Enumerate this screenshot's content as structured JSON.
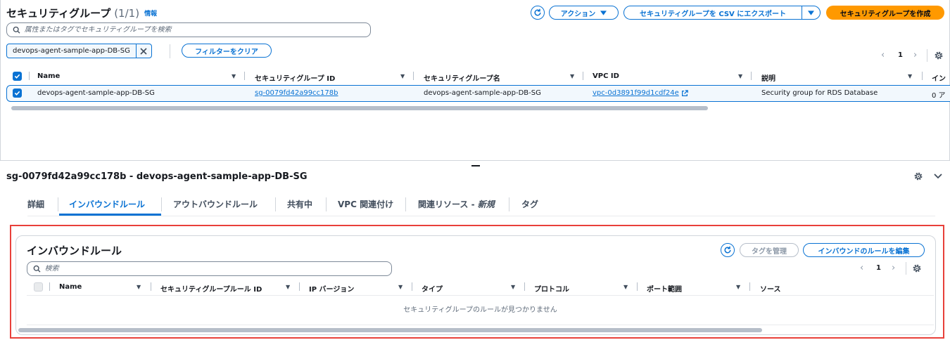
{
  "header": {
    "title": "セキュリティグループ",
    "count": "(1/1)",
    "info": "情報",
    "actions_label": "アクション",
    "export_label": "セキュリティグループを CSV にエクスポート",
    "create_label": "セキュリティグループを作成"
  },
  "search": {
    "placeholder": "属性またはタグでセキュリティグループを検索"
  },
  "filter": {
    "token": "devops-agent-sample-app-DB-SG",
    "clear_label": "フィルターをクリア"
  },
  "pagination": {
    "page": "1"
  },
  "table": {
    "columns": [
      "Name",
      "セキュリティグループ ID",
      "セキュリティグループ名",
      "VPC ID",
      "説明",
      "イン"
    ],
    "row": {
      "name": "devops-agent-sample-app-DB-SG",
      "sg_id": "sg-0079fd42a99cc178b",
      "sg_name": "devops-agent-sample-app-DB-SG",
      "vpc_id": "vpc-0d3891f99d1cdf24e",
      "description": "Security group for RDS Database",
      "inbound": "0 ア"
    }
  },
  "detail": {
    "title": "sg-0079fd42a99cc178b - devops-agent-sample-app-DB-SG",
    "tabs": [
      "詳細",
      "インバウンドルール",
      "アウトバウンドルール",
      "共有中",
      "VPC 関連付け",
      "関連リソース - ",
      "タグ"
    ],
    "tab_new": "新規",
    "active_tab": 1
  },
  "inbound": {
    "title": "インバウンドルール",
    "manage_tags_label": "タグを管理",
    "edit_label": "インバウンドのルールを編集",
    "search_placeholder": "検索",
    "page": "1",
    "columns": [
      "Name",
      "セキュリティグループルール ID",
      "IP バージョン",
      "タイプ",
      "プロトコル",
      "ポート範囲",
      "ソース"
    ],
    "empty": "セキュリティグループのルールが見つかりません"
  },
  "colors": {
    "accent": "#0972d3",
    "primary": "#ff9900",
    "highlight": "#e8403a"
  }
}
